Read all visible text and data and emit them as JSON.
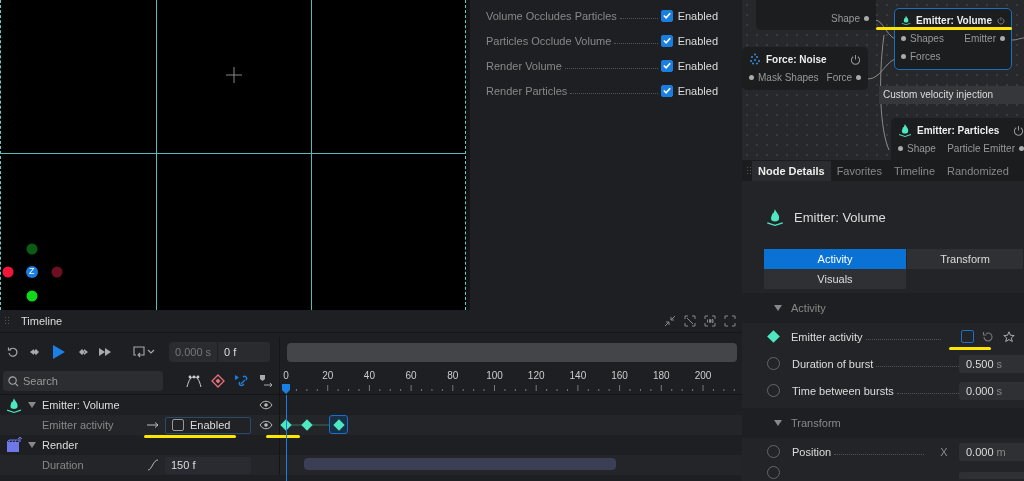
{
  "viewport": {
    "gizmo_label": "Z"
  },
  "render_settings": [
    {
      "label": "Volume Occludes Particles",
      "checked": true,
      "value": "Enabled"
    },
    {
      "label": "Particles Occlude Volume",
      "checked": true,
      "value": "Enabled"
    },
    {
      "label": "Render Volume",
      "checked": true,
      "value": "Enabled"
    },
    {
      "label": "Render Particles",
      "checked": true,
      "value": "Enabled"
    }
  ],
  "node_graph": {
    "nodes": [
      {
        "kind": "partial",
        "ports_out": [
          "Shape"
        ],
        "selected": false
      },
      {
        "kind": "volume",
        "title": "Emitter: Volume",
        "ports_in": [
          "Shapes",
          "Forces"
        ],
        "ports_out": [
          "Emitter"
        ],
        "selected": true
      },
      {
        "kind": "noise",
        "title": "Force: Noise",
        "ports_in": [
          "Mask Shapes"
        ],
        "ports_out": [
          "Force"
        ],
        "selected": false
      },
      {
        "kind": "particles",
        "title": "Emitter: Particles",
        "ports_in": [
          "Shape"
        ],
        "ports_out": [
          "Particle Emitter"
        ],
        "selected": false
      }
    ],
    "group_title": "Custom velocity injection"
  },
  "timeline": {
    "title": "Timeline",
    "time_seconds": "0.000",
    "time_seconds_unit": "s",
    "time_frames": "0 f",
    "search": {
      "placeholder": "Search"
    },
    "ruler": [
      "0",
      "20",
      "40",
      "60",
      "80",
      "100",
      "120",
      "140",
      "160",
      "180",
      "200"
    ],
    "tracks": [
      {
        "kind": "group",
        "label": "Emitter: Volume",
        "expanded": true
      },
      {
        "kind": "toggle",
        "label": "Emitter activity",
        "checked": false,
        "value": "Enabled",
        "keyframes": [
          {
            "selected": false
          },
          {
            "selected": false
          },
          {
            "selected": true
          }
        ]
      },
      {
        "kind": "render",
        "label": "Render",
        "expanded": true
      },
      {
        "kind": "number",
        "label": "Duration",
        "value": "150 f"
      }
    ]
  },
  "node_details": {
    "tabs": [
      {
        "label": "Node Details",
        "selected": true
      },
      {
        "label": "Favorites",
        "selected": false
      },
      {
        "label": "Timeline",
        "selected": false
      },
      {
        "label": "Randomized",
        "selected": false
      }
    ],
    "title": "Emitter: Volume",
    "section_tabs": [
      {
        "label": "Activity",
        "selected": true
      },
      {
        "label": "Transform",
        "selected": false
      },
      {
        "label": "Visuals",
        "selected": false
      }
    ],
    "sections": [
      {
        "title": "Activity",
        "expanded": true,
        "rows": [
          {
            "kind": "checkbox",
            "label": "Emitter activity",
            "keyed": true,
            "checked": false
          },
          {
            "kind": "number",
            "label": "Duration of burst",
            "keyed": false,
            "value": "0.500",
            "unit": "s"
          },
          {
            "kind": "number",
            "label": "Time between bursts",
            "keyed": false,
            "value": "0.000",
            "unit": "s"
          }
        ]
      },
      {
        "title": "Transform",
        "expanded": true,
        "rows": [
          {
            "kind": "vector",
            "label": "Position",
            "keyed": false,
            "axis": "X",
            "value": "0.000",
            "unit": "m"
          }
        ]
      }
    ]
  }
}
